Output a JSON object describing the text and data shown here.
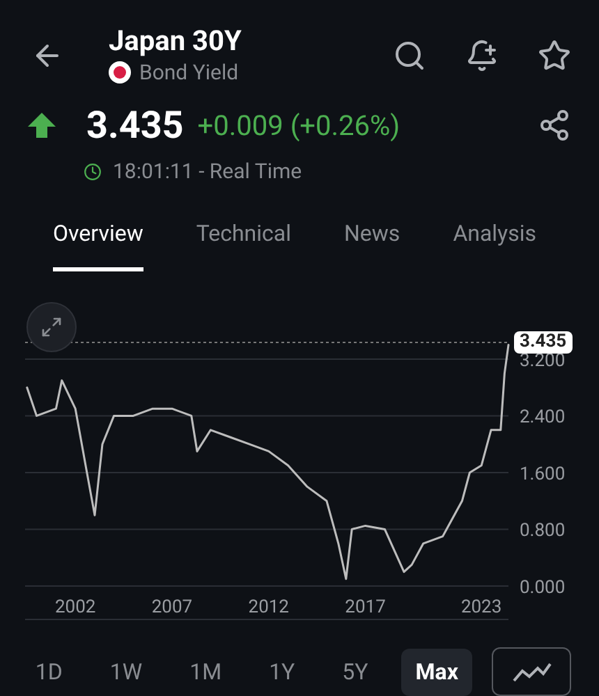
{
  "header": {
    "title": "Japan 30Y",
    "subtitle": "Bond Yield"
  },
  "quote": {
    "price": "3.435",
    "change": "+0.009 (+0.26%)",
    "rising": true,
    "time": "18:01:11 - Real Time"
  },
  "tabs": [
    {
      "label": "Overview",
      "selected": true
    },
    {
      "label": "Technical",
      "selected": false
    },
    {
      "label": "News",
      "selected": false
    },
    {
      "label": "Analysis",
      "selected": false
    }
  ],
  "chart": {
    "last_price": "3.435",
    "chart_data": {
      "type": "line",
      "x": [
        1999.5,
        2000,
        2001,
        2001.3,
        2002,
        2002.6,
        2003,
        2003.4,
        2004,
        2005,
        2006,
        2007,
        2008,
        2008.3,
        2009,
        2010,
        2011,
        2012,
        2013,
        2014,
        2015,
        2015.6,
        2016,
        2016.3,
        2017,
        2018,
        2019,
        2019.4,
        2020,
        2021,
        2022,
        2022.4,
        2023,
        2023.5,
        2024,
        2024.2,
        2024.4
      ],
      "xlim": [
        1999.4,
        2024.4
      ],
      "ylim": [
        0,
        3.435
      ],
      "grid": true,
      "series": [
        {
          "color": "#bdbdbd",
          "values": [
            2.8,
            2.4,
            2.5,
            2.9,
            2.5,
            1.6,
            1.0,
            2.0,
            2.4,
            2.4,
            2.5,
            2.5,
            2.4,
            1.9,
            2.2,
            2.1,
            2.0,
            1.9,
            1.7,
            1.4,
            1.2,
            0.6,
            0.1,
            0.8,
            0.85,
            0.8,
            0.2,
            0.3,
            0.6,
            0.7,
            1.2,
            1.6,
            1.7,
            2.2,
            2.2,
            3.0,
            3.4
          ]
        }
      ],
      "xticks": [
        {
          "value": 2002,
          "label": "2002"
        },
        {
          "value": 2007,
          "label": "2007"
        },
        {
          "value": 2012,
          "label": "2012"
        },
        {
          "value": 2017,
          "label": "2017"
        },
        {
          "value": 2023,
          "label": "2023"
        }
      ],
      "yticks": [
        {
          "value": 0,
          "label": "0.000"
        },
        {
          "value": 0.8,
          "label": "0.800"
        },
        {
          "value": 1.6,
          "label": "1.600"
        },
        {
          "value": 2.4,
          "label": "2.400"
        },
        {
          "value": 3.2,
          "label": "3.200"
        }
      ]
    }
  },
  "ranges": [
    {
      "label": "1D",
      "selected": false
    },
    {
      "label": "1W",
      "selected": false
    },
    {
      "label": "1M",
      "selected": false
    },
    {
      "label": "1Y",
      "selected": false
    },
    {
      "label": "5Y",
      "selected": false
    },
    {
      "label": "Max",
      "selected": true
    }
  ]
}
